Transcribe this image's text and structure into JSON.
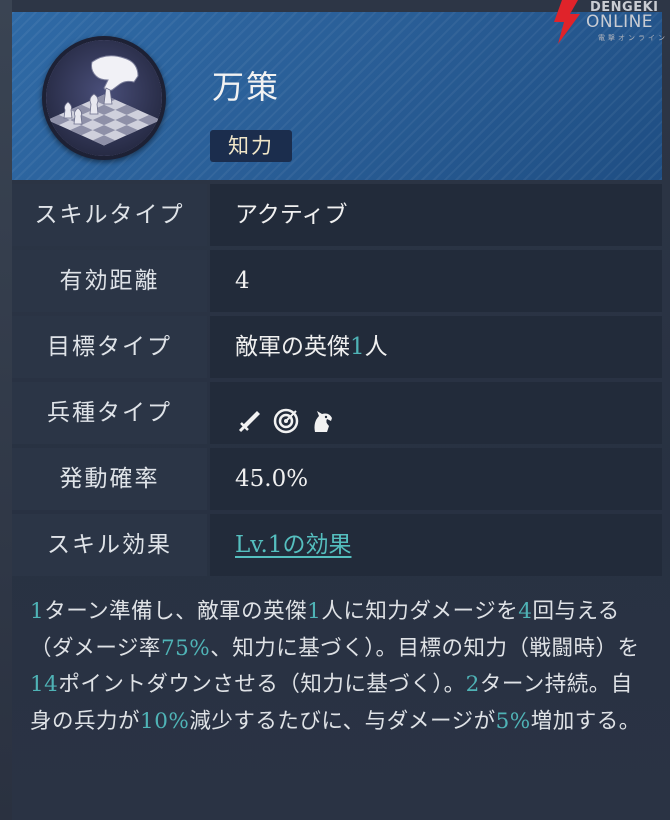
{
  "logo": {
    "line1": "DENGEKI",
    "line2": "ONLINE",
    "line3": "電撃オンライン"
  },
  "skill": {
    "name": "万策",
    "tag": "知力"
  },
  "rows": [
    {
      "label": "スキルタイプ",
      "value": "アクティブ"
    },
    {
      "label": "有効距離",
      "value": "4"
    },
    {
      "label": "目標タイプ",
      "value_pre": "敵軍の英傑",
      "value_num": "1",
      "value_post": "人"
    },
    {
      "label": "兵種タイプ",
      "icons": [
        "sword-icon",
        "archery-target-icon",
        "horse-icon"
      ]
    },
    {
      "label": "発動確率",
      "value": "45.0%"
    },
    {
      "label": "スキル効果",
      "value": "Lv.1の効果"
    }
  ],
  "description": {
    "segments": [
      {
        "t": "1",
        "hl": true
      },
      {
        "t": "ターン準備し、敵軍の英傑",
        "hl": false
      },
      {
        "t": "1",
        "hl": true
      },
      {
        "t": "人に知力ダメージを",
        "hl": false
      },
      {
        "t": "4",
        "hl": true
      },
      {
        "t": "回与える（ダメージ率",
        "hl": false
      },
      {
        "t": "75%",
        "hl": true
      },
      {
        "t": "、知力に基づく）。目標の知力（戦闘時）を",
        "hl": false
      },
      {
        "t": "14",
        "hl": true
      },
      {
        "t": "ポイントダウンさせる（知力に基づく）。",
        "hl": false
      },
      {
        "t": "2",
        "hl": true
      },
      {
        "t": "ターン持続。自身の兵力が",
        "hl": false
      },
      {
        "t": "10%",
        "hl": true
      },
      {
        "t": "減少するたびに、与ダメージが",
        "hl": false
      },
      {
        "t": "5%",
        "hl": true
      },
      {
        "t": "増加する。",
        "hl": false
      }
    ]
  },
  "colors": {
    "accent_cyan": "#4fb3b6",
    "header_blue": "#2f6aa6",
    "logo_red": "#e0232a"
  }
}
